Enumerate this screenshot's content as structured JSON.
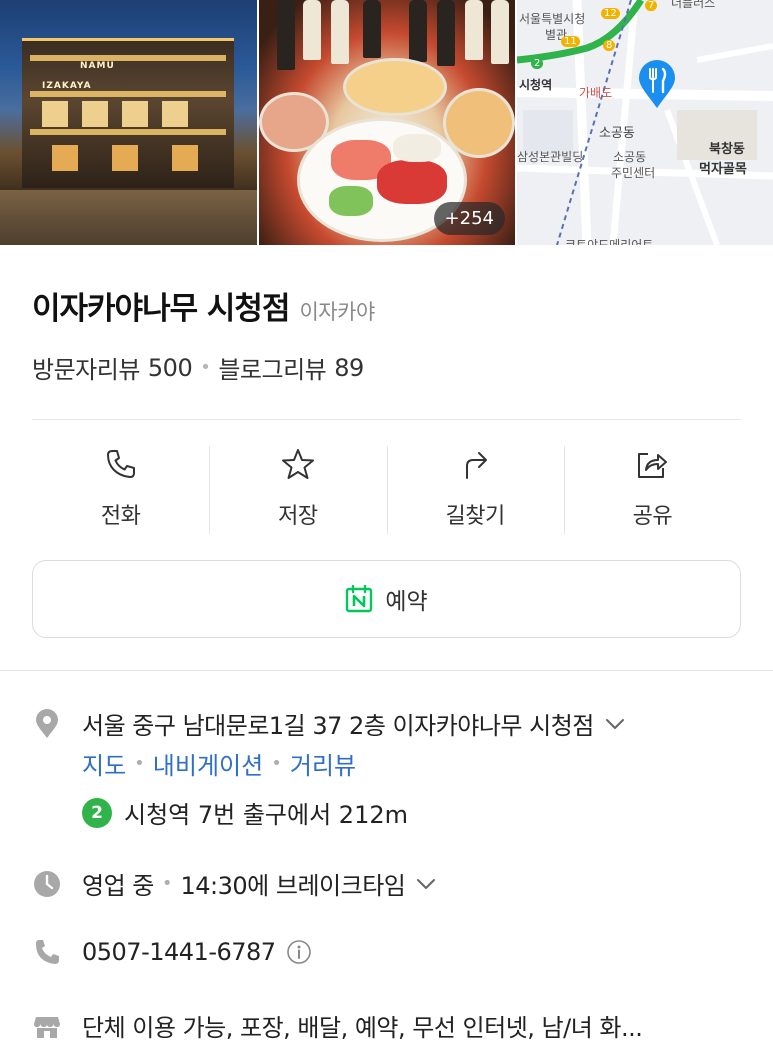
{
  "photos": {
    "more_count": "+254",
    "sign_namu": "NAMU",
    "sign_izakaya": "IZAKAYA",
    "map_labels": [
      "서울특별시청",
      "별관",
      "시청역",
      "가배도",
      "소공동",
      "삼성본관빌딩",
      "소공동",
      "주민센터",
      "북창동",
      "먹자골목",
      "더플러스",
      "코트야드메리어트"
    ],
    "map_badges": [
      "12",
      "7",
      "11",
      "8",
      "2"
    ]
  },
  "place": {
    "name": "이자카야나무 시청점",
    "category": "이자카야",
    "visitor_review_label": "방문자리뷰",
    "visitor_review_count": "500",
    "blog_review_label": "블로그리뷰",
    "blog_review_count": "89"
  },
  "actions": [
    {
      "label": "전화",
      "icon": "phone-icon"
    },
    {
      "label": "저장",
      "icon": "star-icon"
    },
    {
      "label": "길찾기",
      "icon": "directions-icon"
    },
    {
      "label": "공유",
      "icon": "share-icon"
    }
  ],
  "reserve": {
    "label": "예약",
    "badge": "N",
    "color": "#03c75a"
  },
  "info": {
    "address": "서울 중구 남대문로1길 37 2층 이자카야나무 시청점",
    "links": [
      "지도",
      "내비게이션",
      "거리뷰"
    ],
    "subway_line": "2",
    "subway_line_color": "#2fb34a",
    "station_text": "시청역 7번 출구에서 212m",
    "status": "영업 중",
    "status_detail": "14:30에 브레이크타임",
    "phone": "0507-1441-6787",
    "amenities": "단체 이용 가능, 포장, 배달, 예약, 무선 인터넷, 남/녀 화..."
  },
  "colors": {
    "link": "#2f6fca",
    "pin": "#1a8ff0",
    "icon_gray": "#a8a8a8"
  }
}
